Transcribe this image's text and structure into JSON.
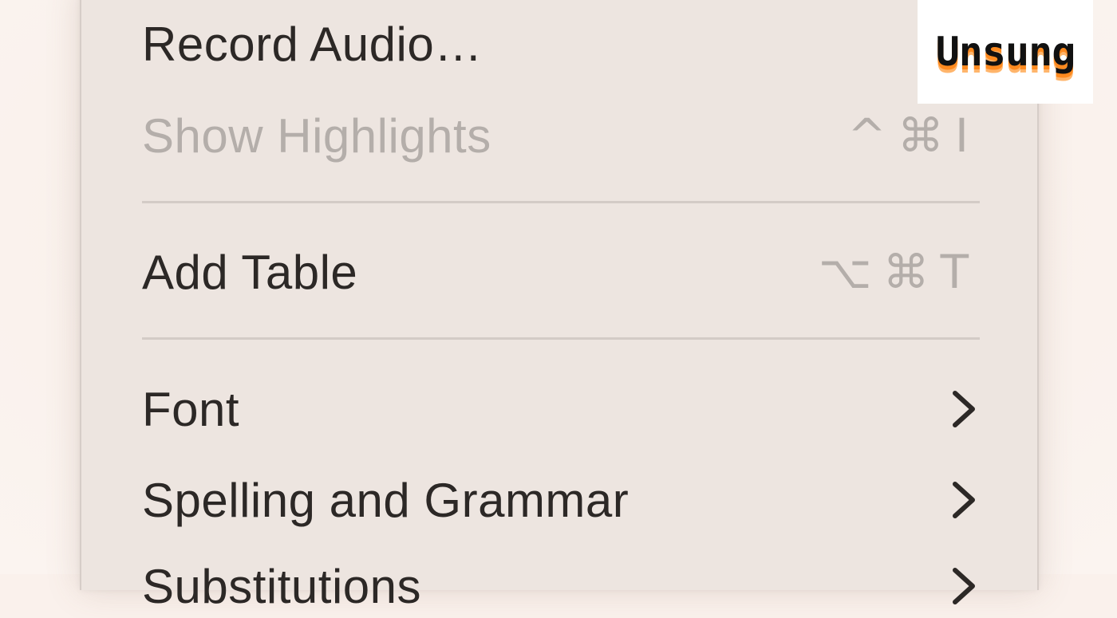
{
  "menu": {
    "items": [
      {
        "label": "Record Audio…",
        "shortcut": "",
        "disabled": false,
        "submenu": false
      },
      {
        "label": "Show Highlights",
        "shortcut": "^⌘I",
        "disabled": true,
        "submenu": false
      },
      {
        "label": "Add Table",
        "shortcut": "⌥⌘T",
        "disabled": false,
        "submenu": false
      },
      {
        "label": "Font",
        "shortcut": "",
        "disabled": false,
        "submenu": true
      },
      {
        "label": "Spelling and Grammar",
        "shortcut": "",
        "disabled": false,
        "submenu": true
      },
      {
        "label": "Substitutions",
        "shortcut": "",
        "disabled": false,
        "submenu": true
      }
    ]
  },
  "logo": {
    "text": "Unsung"
  },
  "colors": {
    "menu_background": "#ede5e0",
    "text": "#2c2826",
    "disabled_text": "#b4aeaa",
    "separator": "#d3cbc6",
    "logo_accent": "#ff8a1f"
  }
}
